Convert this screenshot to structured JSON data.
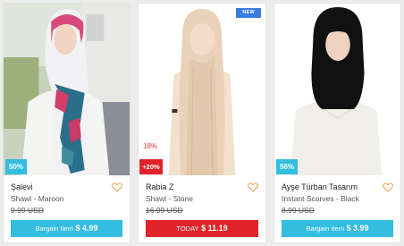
{
  "colors": {
    "bargain_blue": "#33bde0",
    "today_red": "#e0232b",
    "new_blue": "#3b7be0",
    "heart_orange": "#f0a050"
  },
  "products": [
    {
      "brand": "Şalevi",
      "title": "Shawl - Maroon",
      "old_price": "9.99 USD",
      "discount_badge": "50%",
      "price_label": "Bargain Item",
      "price_value": "$ 4.99",
      "image": "woman-in-floral-scarf",
      "favorite_icon": "heart-outline-icon"
    },
    {
      "brand": "Rabia Z",
      "title": "Shawl - Stone",
      "old_price": "16.99 USD",
      "new_badge": "NEW",
      "percent_badge": "18%",
      "discount_badge": "+20%",
      "price_label": "TODAY",
      "price_value": "$ 11.19",
      "image": "woman-in-beige-shawl",
      "favorite_icon": "heart-outline-icon"
    },
    {
      "brand": "Ayşe Türban Tasarım",
      "title": "Instant Scarves - Black",
      "old_price": "8.99 USD",
      "discount_badge": "56%",
      "price_label": "Bargain Item",
      "price_value": "$ 3.99",
      "image": "woman-in-black-hijab",
      "favorite_icon": "heart-outline-icon"
    }
  ]
}
